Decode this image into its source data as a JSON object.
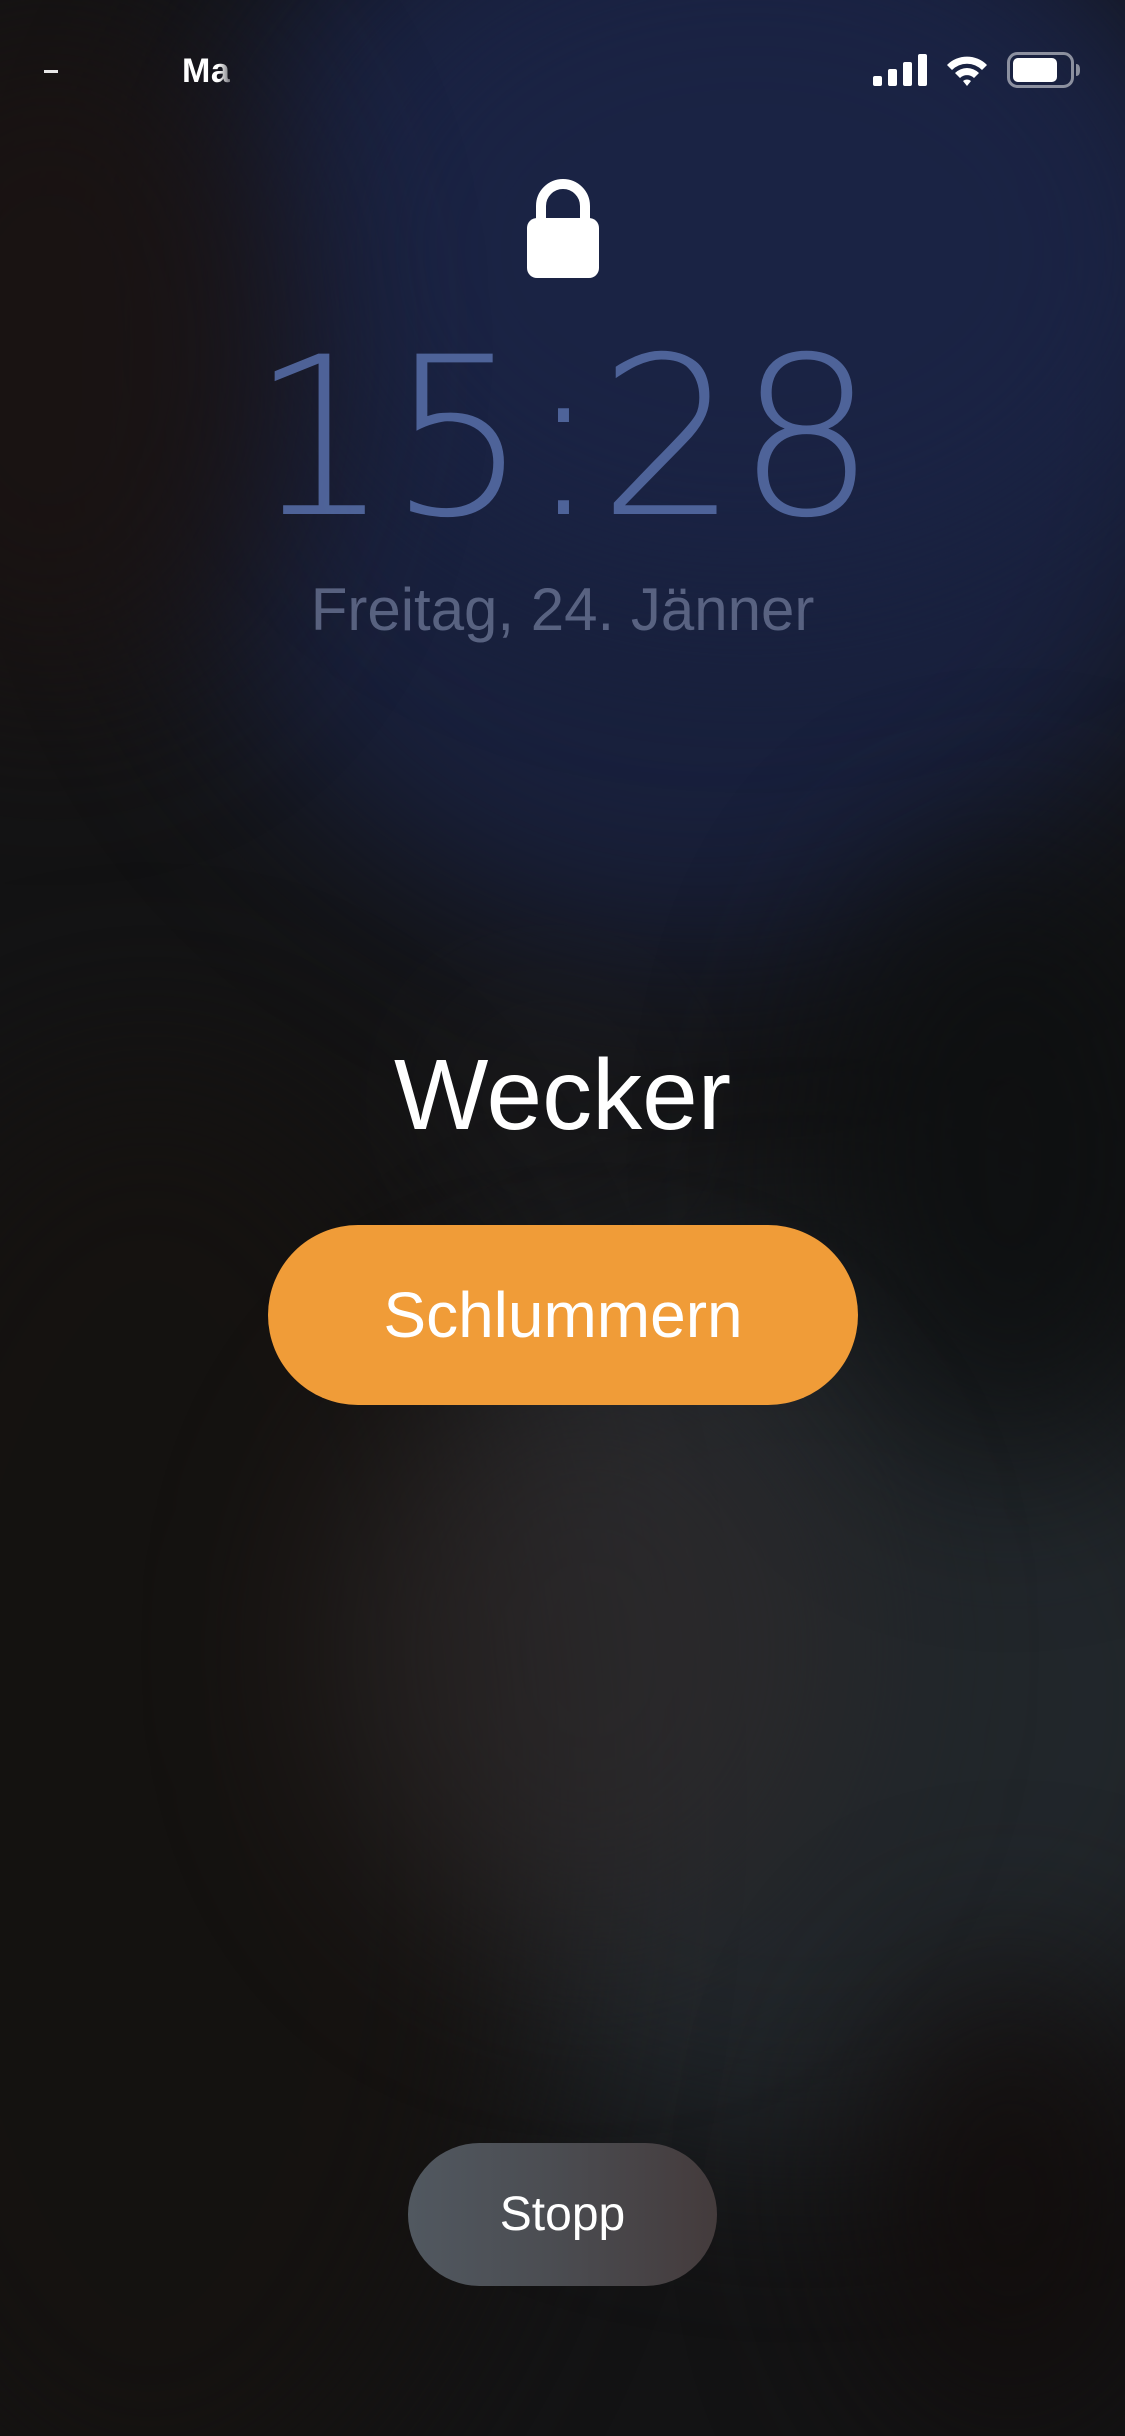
{
  "status_bar": {
    "carrier": "Ma",
    "signal_icon": "cellular-signal-icon",
    "wifi_icon": "wifi-icon",
    "battery_icon": "battery-icon",
    "battery_level": 0.8
  },
  "lock_screen": {
    "lock_icon": "padlock-icon",
    "time": "15:28",
    "date": "Freitag, 24. Jänner"
  },
  "alarm": {
    "title": "Wecker",
    "snooze_label": "Schlummern",
    "stop_label": "Stopp"
  },
  "colors": {
    "snooze_button": "#f09c38",
    "time_text": "#5369a1",
    "stop_button": "#4b4d52"
  }
}
